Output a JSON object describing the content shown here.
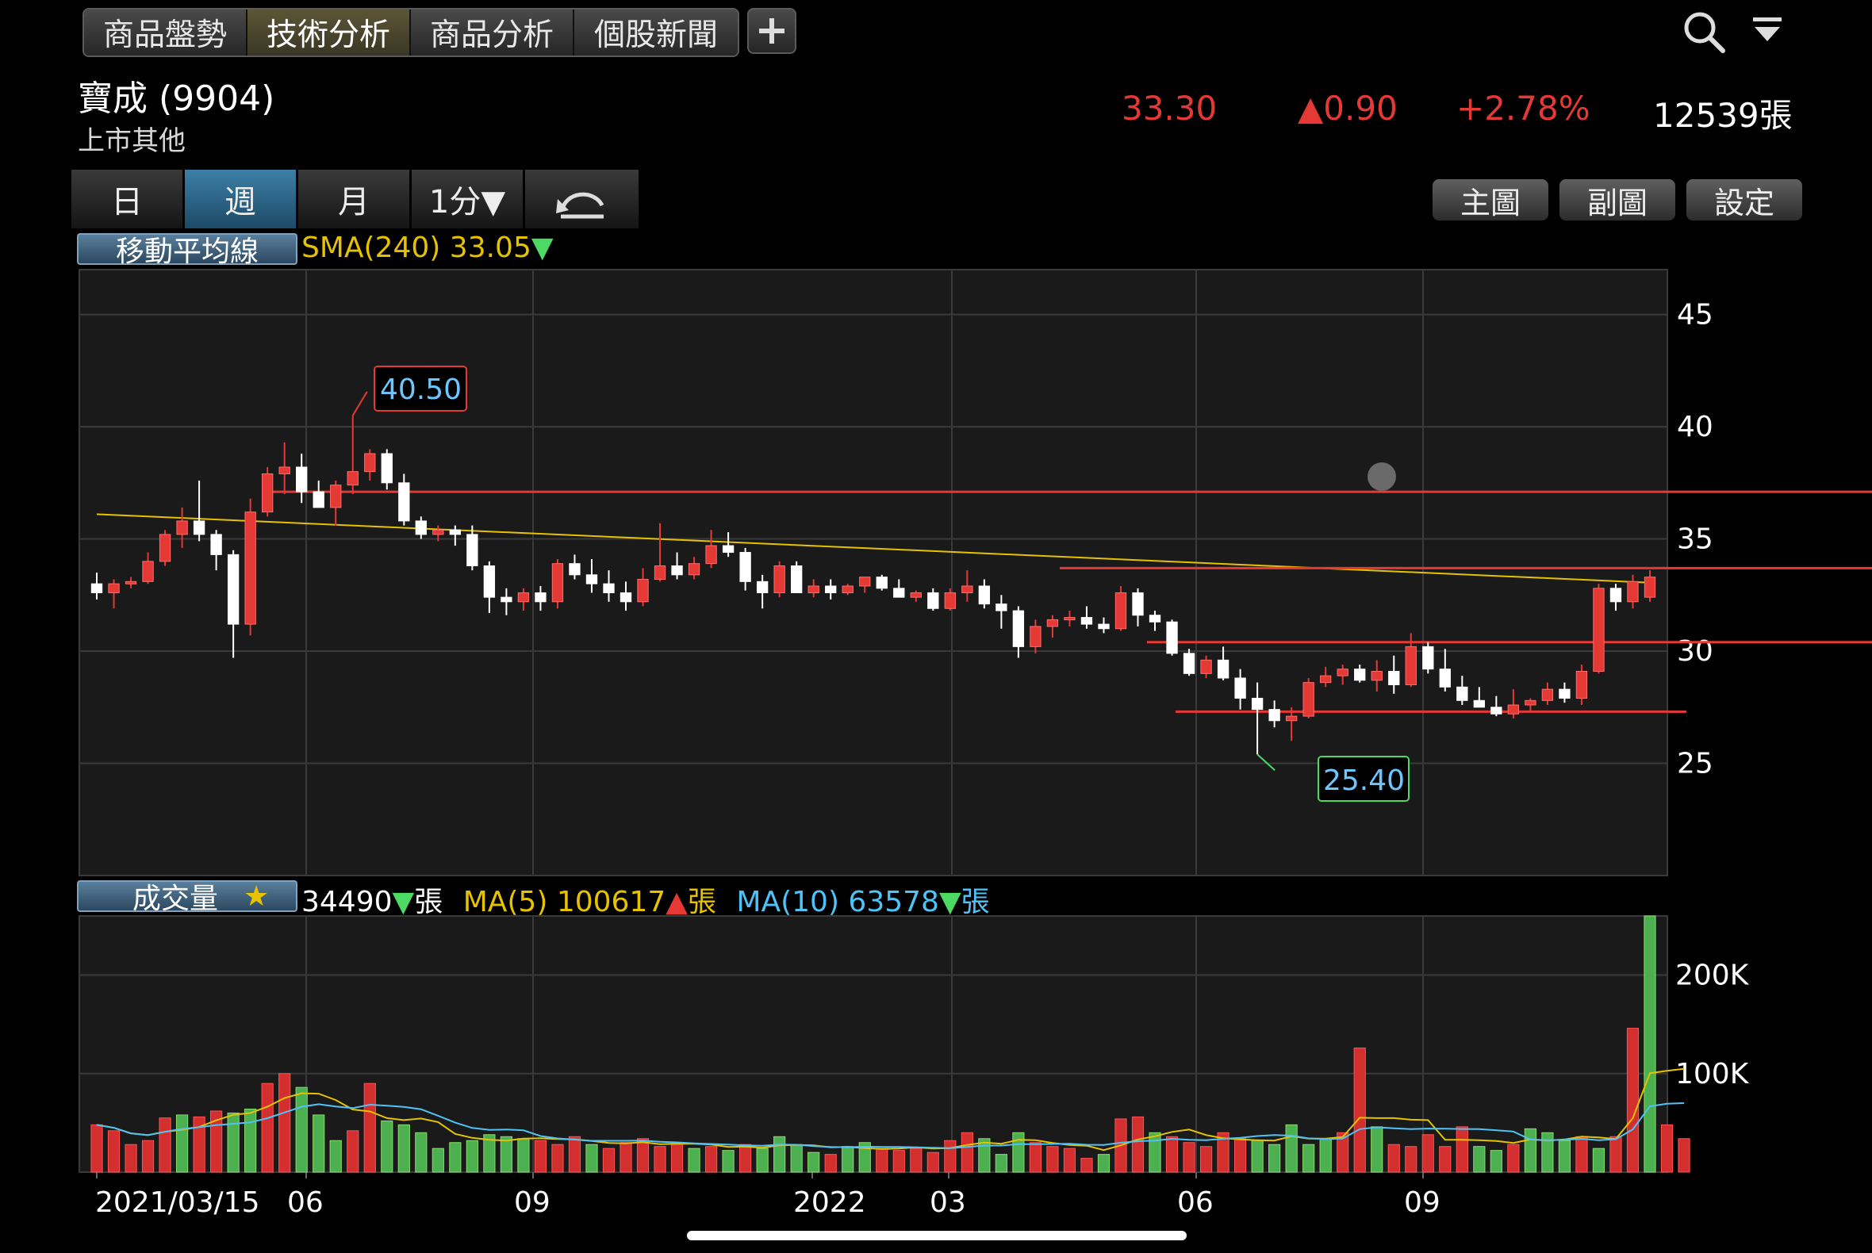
{
  "tabs": [
    "商品盤勢",
    "技術分析",
    "商品分析",
    "個股新聞"
  ],
  "active_tab": 1,
  "stock": {
    "name": "寶成 (9904)",
    "market": "上市其他"
  },
  "quote": {
    "price": "33.30",
    "change": "▲0.90",
    "change_pct": "+2.78%",
    "volume": "12539張"
  },
  "periods": [
    "日",
    "週",
    "月",
    "1分▼"
  ],
  "active_period": 1,
  "right_buttons": [
    "主圖",
    "副圖",
    "設定"
  ],
  "price_panel": {
    "label": "移動平均線",
    "sma_text": "SMA(240) 33.05",
    "high_label": "40.50",
    "low_label": "25.40"
  },
  "volume_panel": {
    "label": "成交量",
    "vol_value": "34490",
    "unit": "張",
    "ma5_text": "MA(5) 100617",
    "ma10_text": "MA(10) 63578"
  },
  "colors": {
    "up": "#e53935",
    "down": "#ffffff",
    "sma": "#e6c200",
    "vol_up": "#d32f2f",
    "vol_down": "#4caf50",
    "ma5": "#e6c200",
    "ma10": "#4fc3f7"
  },
  "chart_data": [
    {
      "type": "candlestick",
      "x_tick_labels": [
        "2021/03/15",
        "06",
        "09",
        "2022",
        "03",
        "06",
        "09"
      ],
      "y_ticks": [
        25,
        30,
        35,
        40,
        45
      ],
      "ylim": [
        20,
        47
      ],
      "grid": true,
      "ohlc": [
        [
          33.0,
          33.5,
          32.3,
          32.6
        ],
        [
          32.6,
          33.2,
          31.9,
          33.0
        ],
        [
          33.0,
          33.3,
          32.8,
          33.1
        ],
        [
          33.1,
          34.4,
          33.0,
          34.0
        ],
        [
          34.0,
          35.4,
          33.8,
          35.2
        ],
        [
          35.2,
          36.4,
          34.6,
          35.8
        ],
        [
          35.8,
          37.6,
          34.9,
          35.2
        ],
        [
          35.2,
          35.4,
          33.6,
          34.3
        ],
        [
          34.3,
          34.5,
          29.7,
          31.2
        ],
        [
          31.2,
          36.8,
          30.7,
          36.2
        ],
        [
          36.2,
          38.2,
          36.0,
          37.9
        ],
        [
          37.9,
          39.3,
          37.0,
          38.2
        ],
        [
          38.2,
          38.8,
          36.6,
          37.1
        ],
        [
          37.1,
          37.6,
          36.4,
          36.4
        ],
        [
          36.4,
          37.6,
          35.6,
          37.4
        ],
        [
          37.4,
          40.5,
          37.0,
          38.0
        ],
        [
          38.0,
          39.0,
          37.6,
          38.8
        ],
        [
          38.8,
          39.0,
          37.2,
          37.5
        ],
        [
          37.5,
          37.9,
          35.6,
          35.8
        ],
        [
          35.8,
          36.0,
          35.0,
          35.2
        ],
        [
          35.2,
          35.6,
          34.9,
          35.4
        ],
        [
          35.4,
          35.6,
          34.7,
          35.2
        ],
        [
          35.2,
          35.6,
          33.6,
          33.8
        ],
        [
          33.8,
          34.0,
          31.7,
          32.4
        ],
        [
          32.4,
          32.8,
          31.6,
          32.2
        ],
        [
          32.2,
          32.8,
          31.8,
          32.6
        ],
        [
          32.6,
          32.9,
          31.8,
          32.2
        ],
        [
          32.2,
          34.1,
          31.9,
          33.9
        ],
        [
          33.9,
          34.3,
          33.2,
          33.4
        ],
        [
          33.4,
          34.1,
          32.6,
          33.0
        ],
        [
          33.0,
          33.6,
          32.2,
          32.6
        ],
        [
          32.6,
          33.1,
          31.8,
          32.2
        ],
        [
          32.2,
          33.7,
          32.0,
          33.2
        ],
        [
          33.2,
          35.7,
          33.1,
          33.8
        ],
        [
          33.8,
          34.4,
          33.2,
          33.4
        ],
        [
          33.4,
          34.2,
          33.2,
          33.9
        ],
        [
          33.9,
          35.4,
          33.7,
          34.7
        ],
        [
          34.7,
          35.3,
          34.2,
          34.4
        ],
        [
          34.4,
          34.6,
          32.7,
          33.1
        ],
        [
          33.1,
          33.4,
          31.9,
          32.6
        ],
        [
          32.6,
          34.0,
          32.4,
          33.8
        ],
        [
          33.8,
          34.0,
          32.6,
          32.6
        ],
        [
          32.6,
          33.2,
          32.4,
          32.9
        ],
        [
          32.9,
          33.2,
          32.3,
          32.6
        ],
        [
          32.6,
          33.0,
          32.5,
          32.9
        ],
        [
          32.9,
          33.2,
          32.6,
          33.3
        ],
        [
          33.3,
          33.4,
          32.7,
          32.8
        ],
        [
          32.8,
          33.2,
          32.4,
          32.4
        ],
        [
          32.4,
          32.7,
          32.2,
          32.6
        ],
        [
          32.6,
          32.8,
          31.8,
          31.9
        ],
        [
          31.9,
          32.8,
          31.8,
          32.6
        ],
        [
          32.6,
          33.6,
          32.2,
          32.9
        ],
        [
          32.9,
          33.2,
          31.9,
          32.1
        ],
        [
          32.1,
          32.5,
          31.0,
          31.8
        ],
        [
          31.8,
          32.0,
          29.7,
          30.2
        ],
        [
          30.2,
          31.4,
          29.9,
          31.1
        ],
        [
          31.1,
          31.6,
          30.6,
          31.4
        ],
        [
          31.4,
          31.8,
          31.1,
          31.5
        ],
        [
          31.5,
          32.0,
          31.0,
          31.2
        ],
        [
          31.2,
          31.5,
          30.8,
          31.0
        ],
        [
          31.0,
          32.9,
          30.9,
          32.6
        ],
        [
          32.6,
          32.8,
          31.1,
          31.6
        ],
        [
          31.6,
          31.8,
          30.9,
          31.3
        ],
        [
          31.3,
          31.4,
          29.8,
          29.9
        ],
        [
          29.9,
          30.1,
          28.9,
          29.0
        ],
        [
          29.0,
          29.8,
          28.8,
          29.6
        ],
        [
          29.6,
          30.2,
          28.7,
          28.8
        ],
        [
          28.8,
          29.2,
          27.4,
          27.9
        ],
        [
          27.9,
          28.6,
          25.4,
          27.4
        ],
        [
          27.4,
          27.8,
          26.6,
          26.9
        ],
        [
          26.9,
          27.5,
          26.0,
          27.1
        ],
        [
          27.1,
          28.8,
          27.0,
          28.6
        ],
        [
          28.6,
          29.3,
          28.4,
          28.9
        ],
        [
          28.9,
          29.4,
          28.5,
          29.2
        ],
        [
          29.2,
          29.4,
          28.6,
          28.7
        ],
        [
          28.7,
          29.6,
          28.2,
          29.1
        ],
        [
          29.1,
          29.8,
          28.1,
          28.5
        ],
        [
          28.5,
          30.8,
          28.4,
          30.2
        ],
        [
          30.2,
          30.4,
          29.0,
          29.2
        ],
        [
          29.2,
          30.1,
          28.2,
          28.4
        ],
        [
          28.4,
          28.9,
          27.6,
          27.8
        ],
        [
          27.8,
          28.4,
          27.5,
          27.5
        ],
        [
          27.5,
          28.0,
          27.1,
          27.2
        ],
        [
          27.2,
          28.3,
          27.0,
          27.6
        ],
        [
          27.6,
          27.9,
          27.3,
          27.8
        ],
        [
          27.8,
          28.6,
          27.6,
          28.3
        ],
        [
          28.3,
          28.6,
          27.7,
          27.9
        ],
        [
          27.9,
          29.4,
          27.6,
          29.1
        ],
        [
          29.1,
          33.0,
          29.0,
          32.8
        ],
        [
          32.8,
          33.0,
          31.8,
          32.2
        ],
        [
          32.2,
          33.4,
          31.9,
          33.1
        ],
        [
          32.4,
          33.6,
          32.2,
          33.3
        ]
      ],
      "sma240": {
        "start": 36.1,
        "end": 33.05
      },
      "horizontal_lines": [
        37.1,
        33.7,
        30.4,
        27.3
      ],
      "high": 40.5,
      "low": 25.4
    },
    {
      "type": "bar",
      "y_ticks": [
        100000,
        200000
      ],
      "ymax": 260000,
      "tick_labels": [
        "100K",
        "200K"
      ],
      "volumes": [
        [
          48000,
          1
        ],
        [
          42000,
          1
        ],
        [
          28000,
          1
        ],
        [
          32000,
          1
        ],
        [
          55000,
          1
        ],
        [
          58000,
          0
        ],
        [
          56000,
          1
        ],
        [
          62000,
          1
        ],
        [
          60000,
          0
        ],
        [
          64000,
          0
        ],
        [
          90000,
          1
        ],
        [
          100000,
          1
        ],
        [
          86000,
          0
        ],
        [
          58000,
          0
        ],
        [
          32000,
          0
        ],
        [
          42000,
          1
        ],
        [
          90000,
          1
        ],
        [
          52000,
          0
        ],
        [
          48000,
          0
        ],
        [
          40000,
          0
        ],
        [
          24000,
          0
        ],
        [
          30000,
          0
        ],
        [
          32000,
          0
        ],
        [
          38000,
          0
        ],
        [
          36000,
          0
        ],
        [
          34000,
          0
        ],
        [
          32000,
          1
        ],
        [
          28000,
          1
        ],
        [
          36000,
          1
        ],
        [
          28000,
          0
        ],
        [
          24000,
          1
        ],
        [
          30000,
          1
        ],
        [
          34000,
          1
        ],
        [
          26000,
          1
        ],
        [
          30000,
          1
        ],
        [
          24000,
          0
        ],
        [
          26000,
          1
        ],
        [
          22000,
          0
        ],
        [
          28000,
          1
        ],
        [
          24000,
          0
        ],
        [
          36000,
          0
        ],
        [
          28000,
          0
        ],
        [
          20000,
          0
        ],
        [
          18000,
          1
        ],
        [
          26000,
          0
        ],
        [
          30000,
          0
        ],
        [
          24000,
          1
        ],
        [
          22000,
          1
        ],
        [
          24000,
          1
        ],
        [
          20000,
          1
        ],
        [
          32000,
          1
        ],
        [
          40000,
          1
        ],
        [
          34000,
          0
        ],
        [
          18000,
          0
        ],
        [
          40000,
          0
        ],
        [
          30000,
          1
        ],
        [
          26000,
          1
        ],
        [
          24000,
          1
        ],
        [
          14000,
          1
        ],
        [
          18000,
          0
        ],
        [
          54000,
          1
        ],
        [
          56000,
          1
        ],
        [
          40000,
          0
        ],
        [
          36000,
          1
        ],
        [
          30000,
          1
        ],
        [
          26000,
          1
        ],
        [
          40000,
          1
        ],
        [
          34000,
          1
        ],
        [
          32000,
          0
        ],
        [
          28000,
          0
        ],
        [
          48000,
          0
        ],
        [
          28000,
          0
        ],
        [
          34000,
          0
        ],
        [
          40000,
          1
        ],
        [
          126000,
          1
        ],
        [
          46000,
          0
        ],
        [
          28000,
          1
        ],
        [
          26000,
          1
        ],
        [
          38000,
          1
        ],
        [
          26000,
          1
        ],
        [
          46000,
          1
        ],
        [
          26000,
          0
        ],
        [
          22000,
          0
        ],
        [
          28000,
          1
        ],
        [
          44000,
          0
        ],
        [
          40000,
          0
        ],
        [
          32000,
          0
        ],
        [
          36000,
          1
        ],
        [
          24000,
          0
        ],
        [
          36000,
          1
        ],
        [
          146000,
          1
        ],
        [
          260000,
          0
        ],
        [
          48000,
          1
        ],
        [
          34000,
          1
        ]
      ]
    }
  ]
}
